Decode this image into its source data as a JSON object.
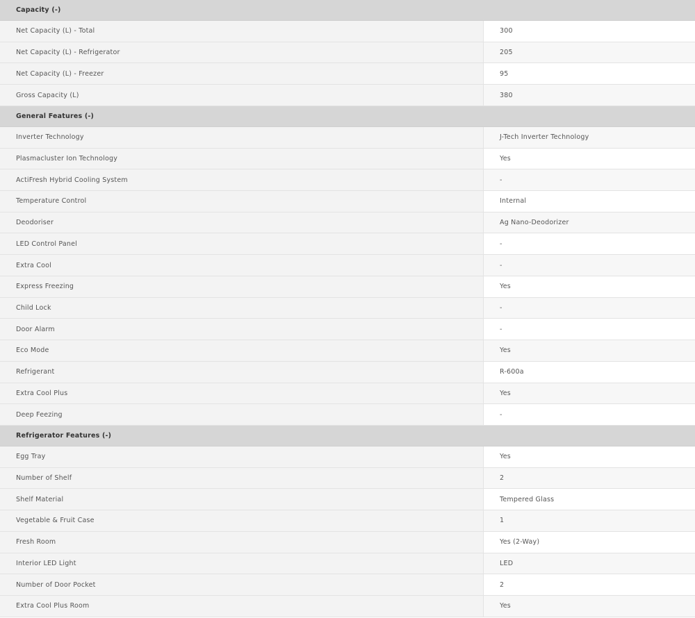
{
  "sections": [
    {
      "title": "Capacity (-)",
      "rows": [
        {
          "label": "Net Capacity (L) - Total",
          "value": "300"
        },
        {
          "label": "Net Capacity (L) - Refrigerator",
          "value": "205"
        },
        {
          "label": "Net Capacity (L) - Freezer",
          "value": "95"
        },
        {
          "label": "Gross Capacity (L)",
          "value": "380"
        }
      ]
    },
    {
      "title": "General Features (-)",
      "rows": [
        {
          "label": "Inverter Technology",
          "value": "J-Tech Inverter Technology"
        },
        {
          "label": "Plasmacluster Ion Technology",
          "value": "Yes"
        },
        {
          "label": "ActiFresh Hybrid Cooling System",
          "value": "-"
        },
        {
          "label": "Temperature Control",
          "value": "Internal"
        },
        {
          "label": "Deodoriser",
          "value": "Ag Nano-Deodorizer"
        },
        {
          "label": "LED Control Panel",
          "value": "-"
        },
        {
          "label": "Extra Cool",
          "value": "-"
        },
        {
          "label": "Express Freezing",
          "value": "Yes"
        },
        {
          "label": "Child Lock",
          "value": "-"
        },
        {
          "label": "Door Alarm",
          "value": "-"
        },
        {
          "label": "Eco Mode",
          "value": "Yes"
        },
        {
          "label": "Refrigerant",
          "value": "R-600a"
        },
        {
          "label": "Extra Cool Plus",
          "value": "Yes"
        },
        {
          "label": "Deep Feezing",
          "value": "-"
        }
      ]
    },
    {
      "title": "Refrigerator Features (-)",
      "rows": [
        {
          "label": "Egg Tray",
          "value": "Yes"
        },
        {
          "label": "Number of Shelf",
          "value": "2"
        },
        {
          "label": "Shelf Material",
          "value": "Tempered Glass"
        },
        {
          "label": "Vegetable & Fruit Case",
          "value": "1"
        },
        {
          "label": "Fresh Room",
          "value": "Yes (2-Way)"
        },
        {
          "label": "Interior LED Light",
          "value": "LED"
        },
        {
          "label": "Number of Door Pocket",
          "value": "2"
        },
        {
          "label": "Extra Cool Plus Room",
          "value": "Yes"
        }
      ]
    }
  ]
}
